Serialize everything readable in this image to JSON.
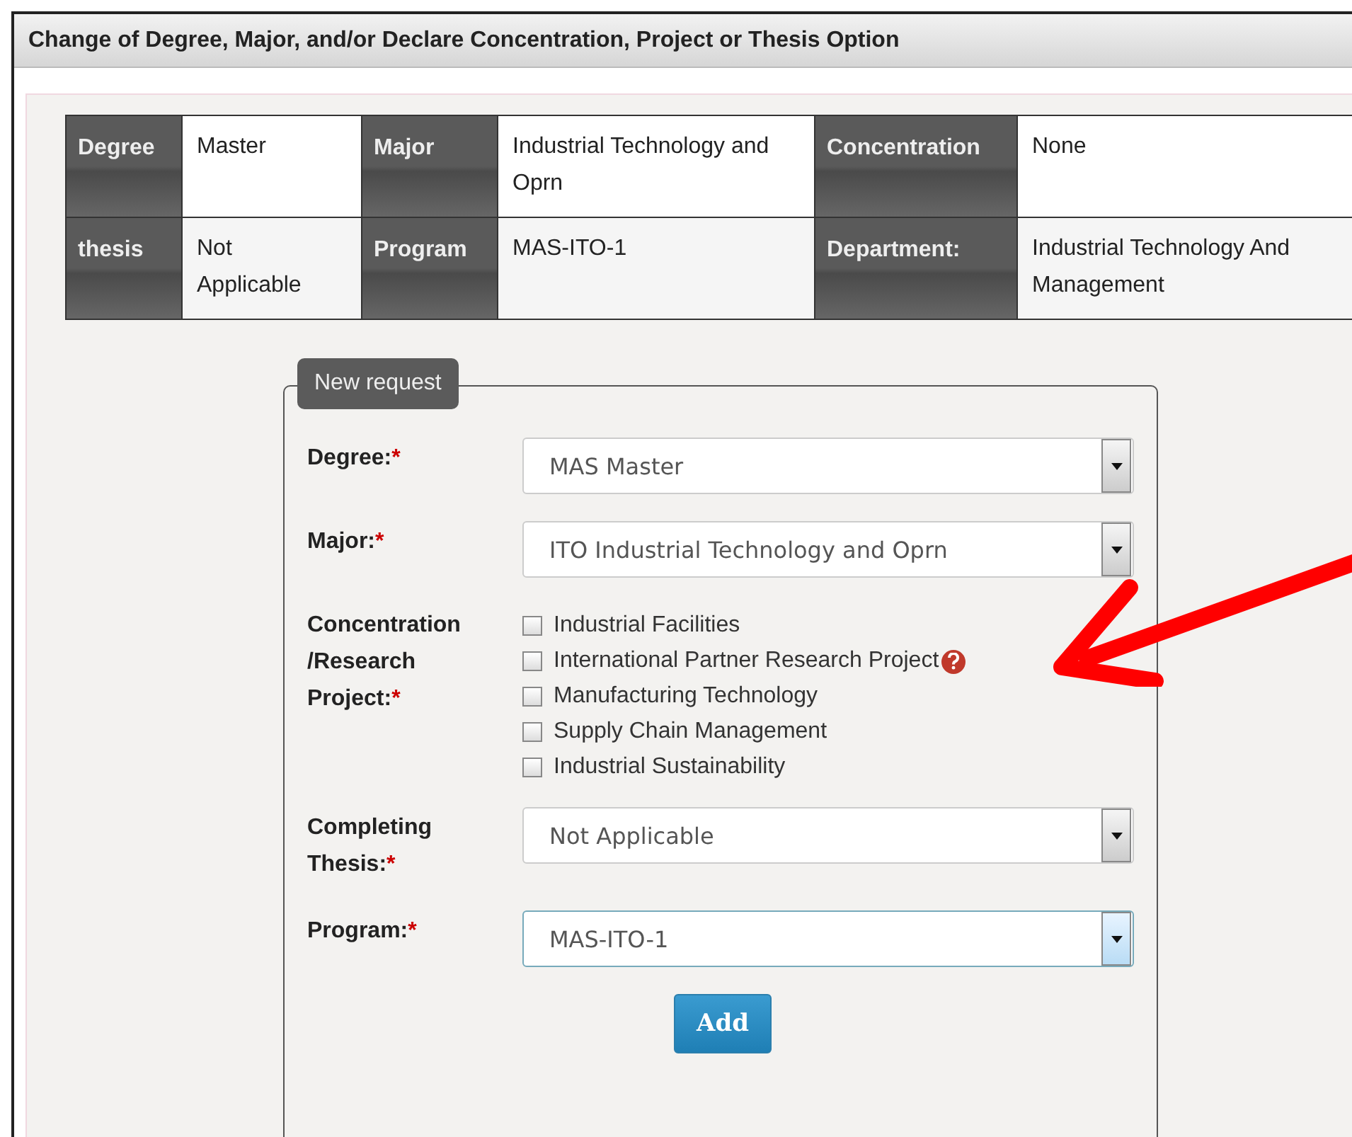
{
  "header": {
    "title": "Change of Degree, Major, and/or Declare Concentration, Project or Thesis Option"
  },
  "current": {
    "rows": [
      [
        {
          "label": "Degree",
          "value": "Master"
        },
        {
          "label": "Major",
          "value": "Industrial Technology and Oprn"
        },
        {
          "label": "Concentration",
          "value": "None"
        }
      ],
      [
        {
          "label": "thesis",
          "value": "Not Applicable"
        },
        {
          "label": "Program",
          "value": "MAS-ITO-1"
        },
        {
          "label": "Department:",
          "value": "Industrial Technology And Management"
        }
      ]
    ]
  },
  "form": {
    "legend": "New request",
    "fields": [
      {
        "kind": "select",
        "label": "Degree:",
        "required_mark": "*",
        "value": "MAS Master",
        "focused": false
      },
      {
        "kind": "select",
        "label": "Major:",
        "required_mark": "*",
        "value": "ITO Industrial Technology and Oprn",
        "focused": false
      },
      {
        "kind": "checkboxes",
        "label": "Concentration /Research Project:",
        "required_mark": "*",
        "options": [
          {
            "label": "Industrial Facilities",
            "checked": false,
            "help": false
          },
          {
            "label": "International Partner Research Project",
            "checked": false,
            "help": true
          },
          {
            "label": "Manufacturing Technology",
            "checked": false,
            "help": false
          },
          {
            "label": "Supply Chain Management",
            "checked": false,
            "help": false
          },
          {
            "label": "Industrial Sustainability",
            "checked": false,
            "help": false
          }
        ]
      },
      {
        "kind": "select",
        "label": "Completing Thesis:",
        "required_mark": "*",
        "value": "Not Applicable",
        "focused": false
      },
      {
        "kind": "select",
        "label": "Program:",
        "required_mark": "*",
        "value": "MAS-ITO-1",
        "focused": true
      }
    ],
    "button": "Add"
  }
}
